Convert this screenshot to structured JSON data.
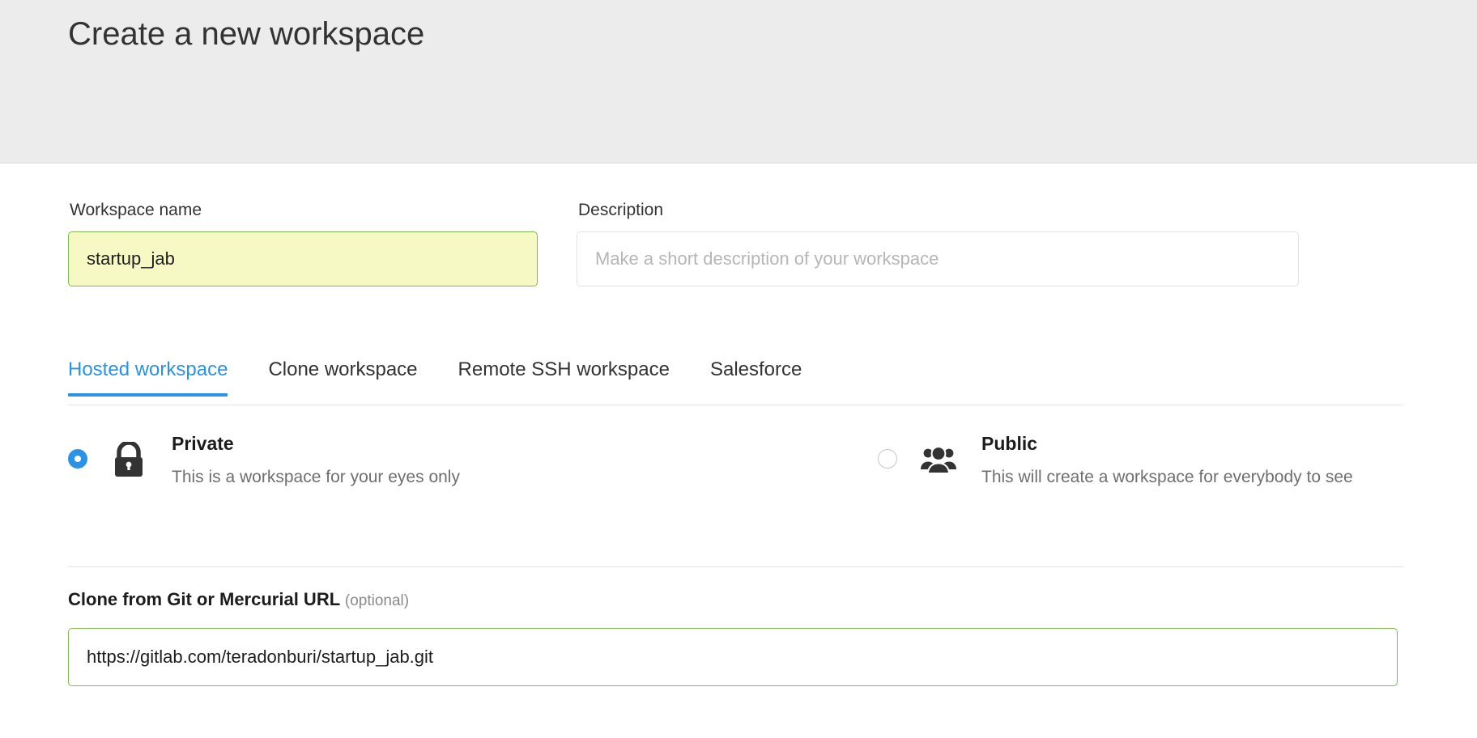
{
  "header": {
    "title": "Create a new workspace"
  },
  "form": {
    "workspace_name": {
      "label": "Workspace name",
      "value": "startup_jab",
      "placeholder": "Workspace name"
    },
    "description": {
      "label": "Description",
      "value": "",
      "placeholder": "Make a short description of your workspace"
    }
  },
  "tabs": [
    {
      "label": "Hosted workspace",
      "active": true
    },
    {
      "label": "Clone workspace",
      "active": false
    },
    {
      "label": "Remote SSH workspace",
      "active": false
    },
    {
      "label": "Salesforce",
      "active": false
    }
  ],
  "visibility": {
    "private": {
      "title": "Private",
      "description": "This is a workspace for your eyes only",
      "icon": "lock-icon",
      "selected": true
    },
    "public": {
      "title": "Public",
      "description": "This will create a workspace for everybody to see",
      "icon": "users-icon",
      "selected": false
    }
  },
  "clone": {
    "label": "Clone from Git or Mercurial URL",
    "optional": "(optional)",
    "value": "https://gitlab.com/teradonburi/startup_jab.git",
    "placeholder": "https://"
  },
  "colors": {
    "header_bg": "#ececec",
    "accent_blue": "#2a93e8",
    "valid_green": "#7fb950",
    "autofill_yellow": "#f7f9c4",
    "text_dark": "#333333",
    "text_muted": "#6f6f6f"
  }
}
